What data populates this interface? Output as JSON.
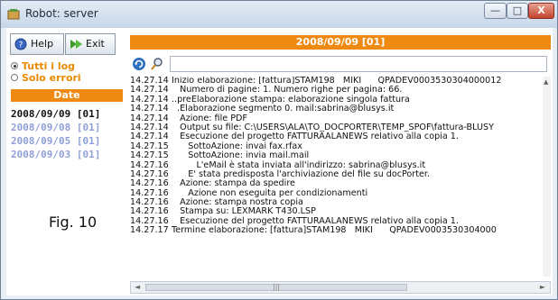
{
  "window": {
    "title": "Robot: server",
    "controls": {
      "minimize": "—",
      "maximize": "□",
      "close": "X"
    }
  },
  "toolbar": {
    "help_label": "Help",
    "exit_label": "Exit"
  },
  "filter": {
    "options": [
      {
        "label": "Tutti i log",
        "selected": true
      },
      {
        "label": "Solo errori",
        "selected": false
      }
    ]
  },
  "dates": {
    "header": "Date",
    "items": [
      {
        "label": "2008/09/09 [01]",
        "selected": true
      },
      {
        "label": "2008/09/08 [01]",
        "selected": false
      },
      {
        "label": "2008/09/05 [01]",
        "selected": false
      },
      {
        "label": "2008/09/03 [01]",
        "selected": false
      }
    ]
  },
  "figure_label": "Fig. 10",
  "log_panel": {
    "header": "2008/09/09 [01]",
    "search_value": "",
    "lines": [
      {
        "time": "14.27.14",
        "text": "Inizio elaborazione: [fattura]STAM198   MIKI      QPADEV0003530304000012"
      },
      {
        "time": "14.27.14",
        "text": "   Numero di pagine: 1. Numero righe per pagina: 66."
      },
      {
        "time": "14.27.14",
        "text": "..preElaborazione stampa: elaborazione singola fattura"
      },
      {
        "time": "14.27.14",
        "text": "  .Elaborazione segmento 0. mail:sabrina@blusys.it"
      },
      {
        "time": "14.27.14",
        "text": "   Azione: file PDF"
      },
      {
        "time": "14.27.14",
        "text": "   Output su file: C:\\USERS\\ALA\\TO_DOCPORTER\\TEMP_SPOF\\fattura-BLUSY"
      },
      {
        "time": "14.27.14",
        "text": "   Esecuzione del progetto FATTURAALANEWS relativo alla copia 1."
      },
      {
        "time": "14.27.15",
        "text": "      SottoAzione: invai fax.rfax"
      },
      {
        "time": "14.27.15",
        "text": "      SottoAzione: invia mail.mail"
      },
      {
        "time": "14.27.16",
        "text": "         L'eMail è stata inviata all'indirizzo: sabrina@blusys.it"
      },
      {
        "time": "14.27.16",
        "text": "      E' stata predisposta l'archiviazione del file su docPorter."
      },
      {
        "time": "14.27.16",
        "text": "   Azione: stampa da spedire"
      },
      {
        "time": "14.27.16",
        "text": "      Azione non eseguita per condizionamenti"
      },
      {
        "time": "14.27.16",
        "text": "   Azione: stampa nostra copia"
      },
      {
        "time": "14.27.16",
        "text": "   Stampa su: LEXMARK T430.LSP"
      },
      {
        "time": "14.27.16",
        "text": "   Esecuzione del progetto FATTURAALANEWS relativo alla copia 1."
      },
      {
        "time": "14.27.17",
        "text": "Termine elaborazione: [fattura]STAM198   MIKI      QPADEV0003530304000"
      }
    ]
  },
  "colors": {
    "accent": "#ee8a12",
    "date_inactive": "#8fa0d8",
    "filter_text": "#e98b00"
  },
  "icons": [
    "app-icon",
    "help-icon",
    "exit-icon",
    "refresh-icon",
    "search-icon"
  ]
}
